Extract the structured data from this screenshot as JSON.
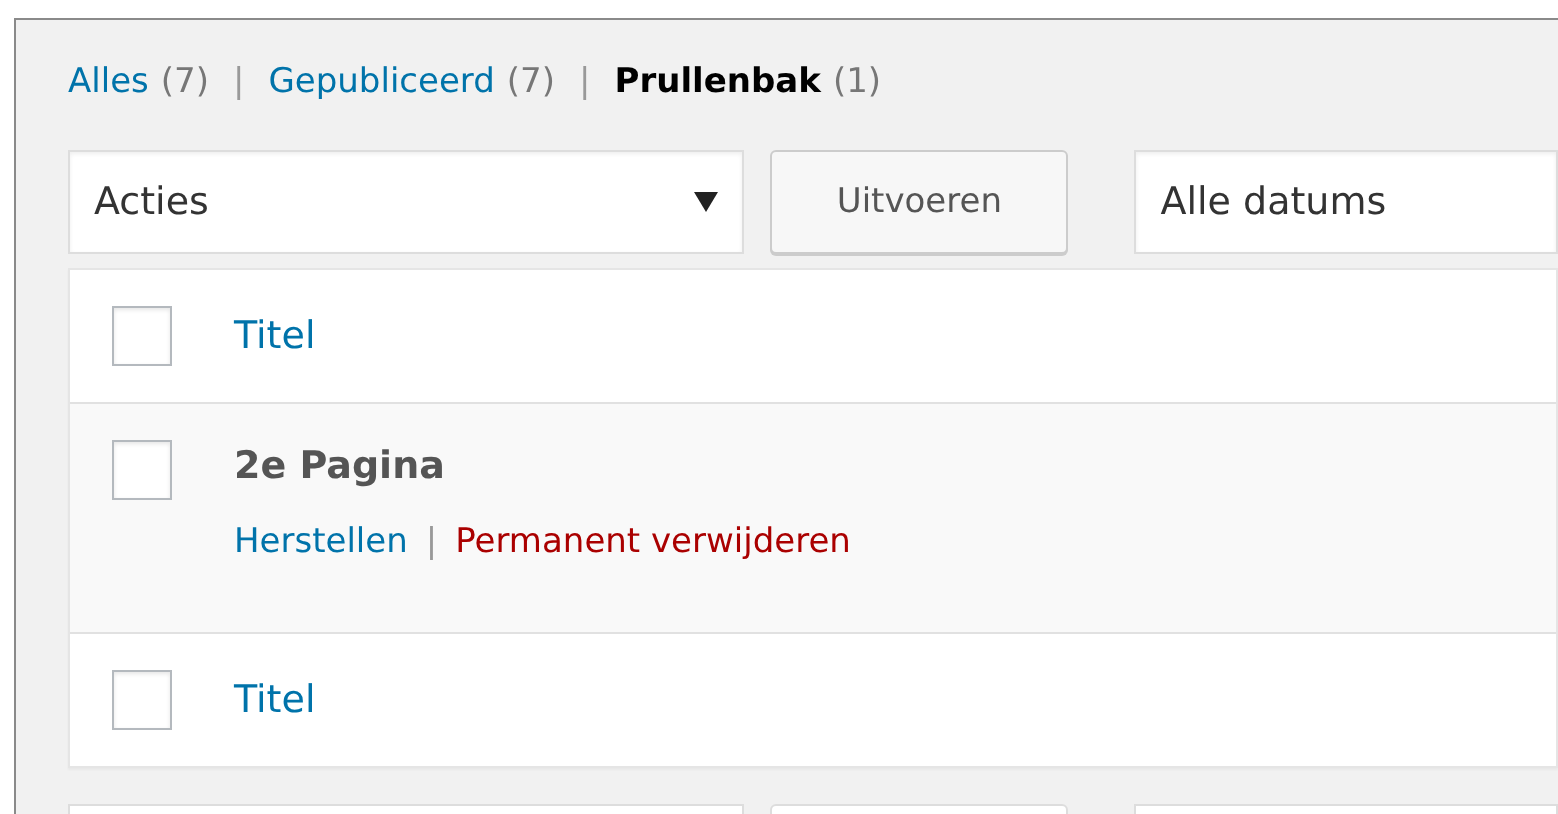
{
  "filters": [
    {
      "label": "Alles",
      "count": "(7)",
      "selected": false
    },
    {
      "label": "Gepubliceerd",
      "count": "(7)",
      "selected": false
    },
    {
      "label": "Prullenbak",
      "count": "(1)",
      "selected": true
    }
  ],
  "filter_separator": "|",
  "toolbar": {
    "bulk_action": "Acties",
    "apply_button": "Uitvoeren",
    "date_filter": "Alle datums"
  },
  "table": {
    "header": {
      "column": "Titel",
      "checked": false
    },
    "rows": [
      {
        "title": "2e Pagina",
        "checked": false,
        "actions": [
          {
            "label": "Herstellen",
            "kind": "restore"
          },
          {
            "label": "Permanent verwijderen",
            "kind": "delete"
          }
        ]
      }
    ],
    "action_separator": "|",
    "footer": {
      "column": "Titel",
      "checked": false
    }
  }
}
